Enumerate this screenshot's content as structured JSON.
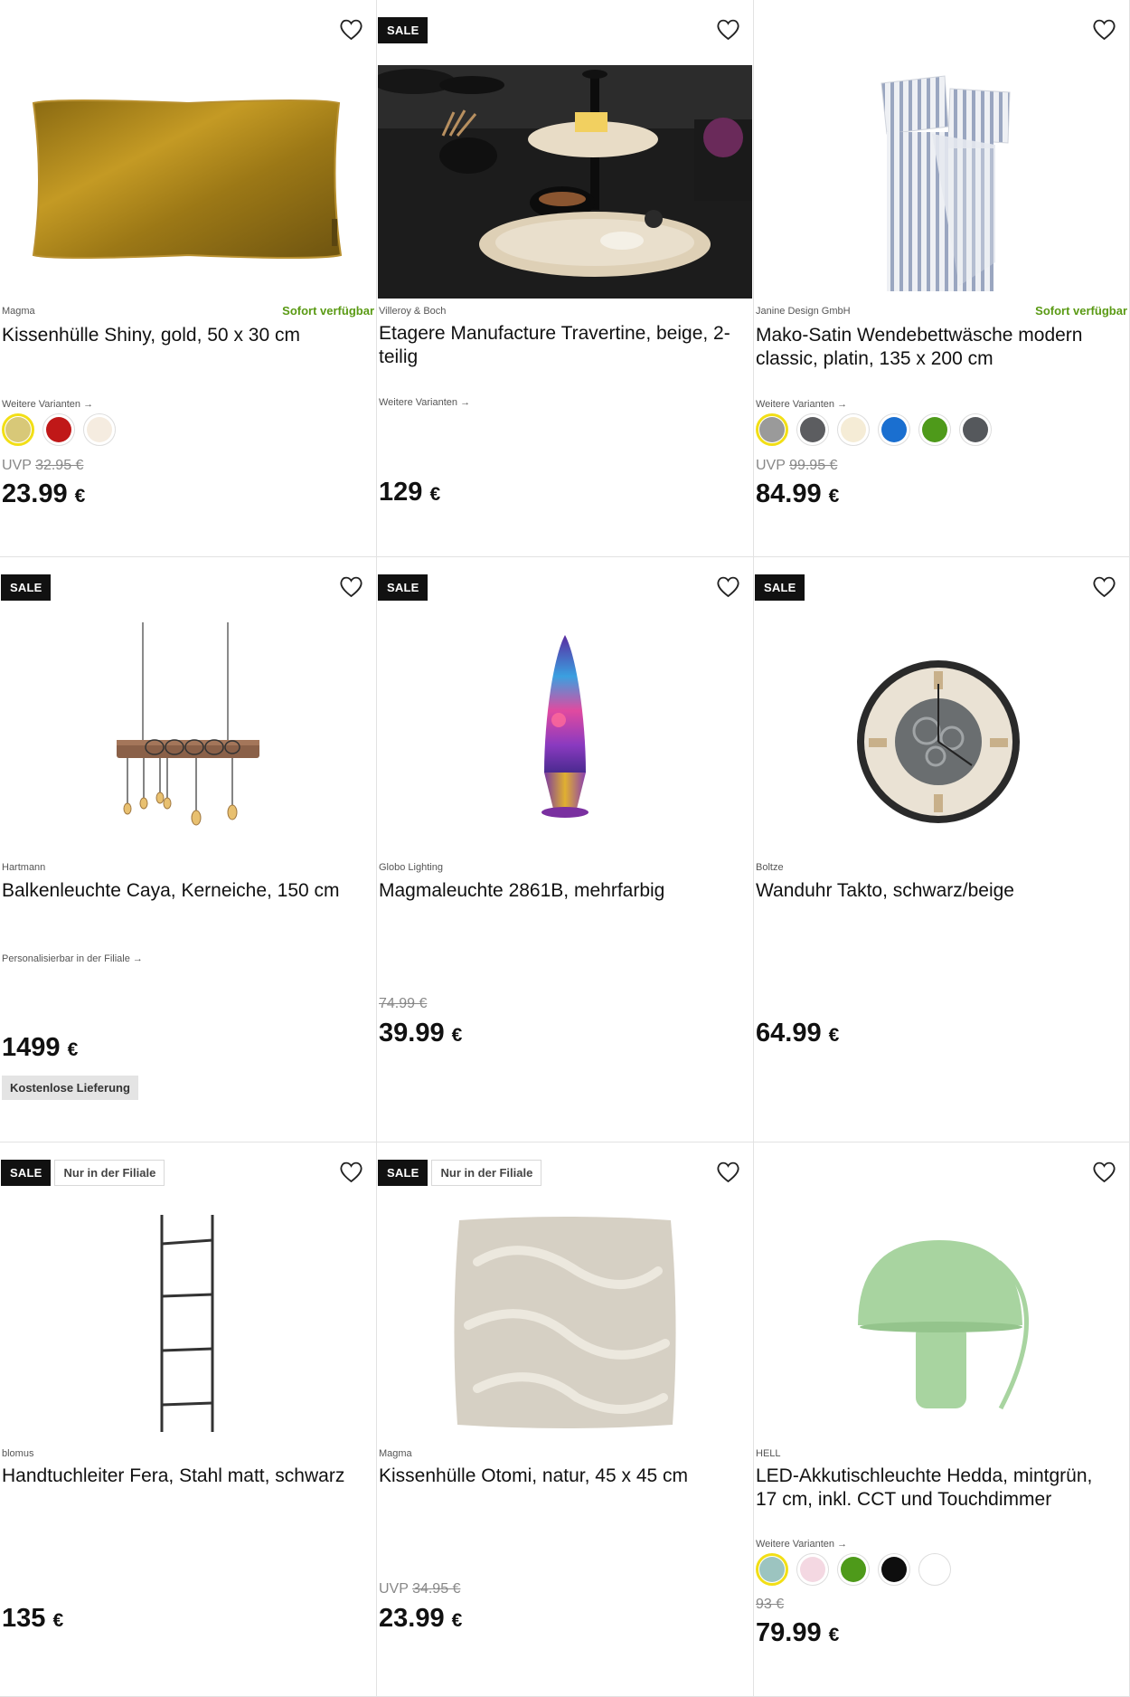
{
  "labels": {
    "sale": "SALE",
    "store_only": "Nur in der Filiale",
    "available": "Sofort verfügbar",
    "more_variants": "Weitere Varianten →",
    "personalizable": "Personalisierbar in der Filiale →",
    "free_delivery": "Kostenlose Lieferung",
    "uvp": "UVP"
  },
  "colors": {
    "sale_badge": "#111111",
    "available": "#5a9a14",
    "selected_swatch_ring": "#f2df16"
  },
  "products": [
    {
      "brand": "Magma",
      "title": "Kissenhülle Shiny, gold, 50 x 30 cm",
      "available": true,
      "old_price": "32.95 €",
      "price": "23.99",
      "currency": "€",
      "image": "gold-velvet-cushion",
      "swatches": [
        "#d8c878",
        "#c01818",
        "#f5ece0"
      ]
    },
    {
      "brand": "Villeroy & Boch",
      "title": "Etagere Manufacture Travertine, beige, 2-teilig",
      "sale": true,
      "price": "129",
      "currency": "€",
      "image": "travertine-etagere"
    },
    {
      "brand": "Janine Design GmbH",
      "title": "Mako-Satin Wendebettwäsche modern classic, platin, 135 x 200 cm",
      "available": true,
      "old_price": "99.95 €",
      "price": "84.99",
      "currency": "€",
      "image": "striped-bedding",
      "swatches": [
        "#9a9a9a",
        "#5c5d60",
        "#f5ecd6",
        "#1a6fd0",
        "#4e9a1a",
        "#55585c"
      ]
    },
    {
      "brand": "Hartmann",
      "title": "Balkenleuchte Caya, Kerneiche, 150 cm",
      "sale": true,
      "price": "1499",
      "currency": "€",
      "image": "beam-pendant-lamp"
    },
    {
      "brand": "Globo Lighting",
      "title": "Magmaleuchte 2861B, mehrfarbig",
      "sale": true,
      "old_price": "74.99 €",
      "price": "39.99",
      "currency": "€",
      "image": "lava-lamp"
    },
    {
      "brand": "Boltze",
      "title": "Wanduhr Takto, schwarz/beige",
      "sale": true,
      "price": "64.99",
      "currency": "€",
      "image": "wall-clock"
    },
    {
      "brand": "blomus",
      "title": "Handtuchleiter Fera, Stahl matt, schwarz",
      "sale": true,
      "store_only": true,
      "price": "135",
      "currency": "€",
      "image": "towel-ladder"
    },
    {
      "brand": "Magma",
      "title": "Kissenhülle Otomi, natur, 45 x 45 cm",
      "sale": true,
      "store_only": true,
      "old_price": "34.95 €",
      "price": "23.99",
      "currency": "€",
      "image": "tufted-cushion"
    },
    {
      "brand": "HELL",
      "title": "LED-Akkutischleuchte Hedda, mintgrün, 17 cm, inkl. CCT und Touchdimmer",
      "old_price": "93 €",
      "price": "79.99",
      "currency": "€",
      "image": "mushroom-table-lamp",
      "swatches": [
        "#9cc4c0",
        "#f4d8e2",
        "#4e9a1a",
        "#0e0e0e",
        "#ffffff"
      ]
    }
  ]
}
